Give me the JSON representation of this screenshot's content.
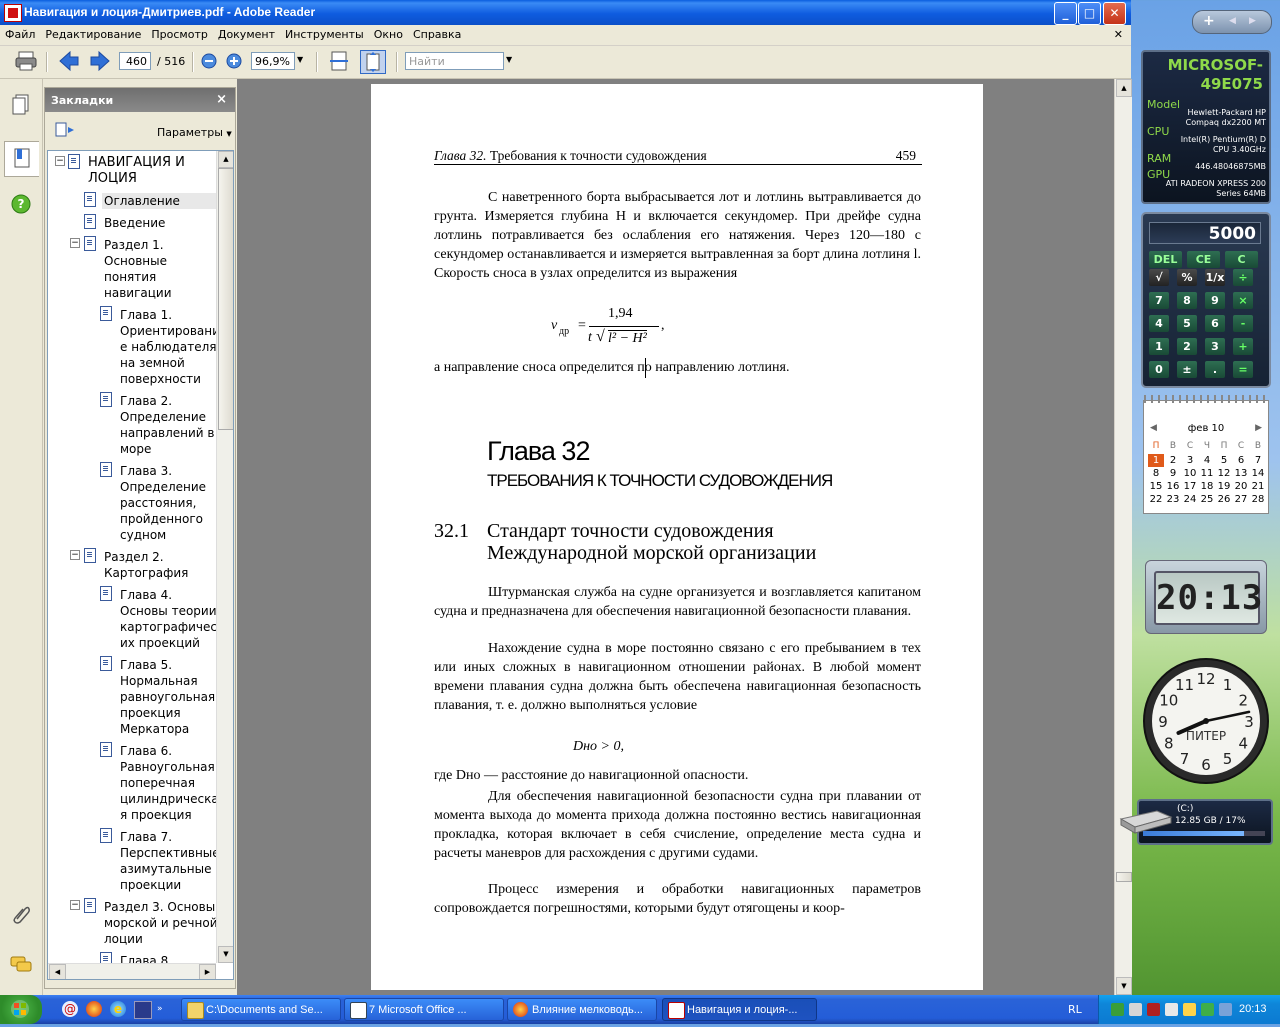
{
  "window": {
    "title": "Навигация и лоция-Дмитриев.pdf - Adobe Reader",
    "controls": {
      "minimize": "_",
      "maximize": "□",
      "close": "✕"
    }
  },
  "menu": [
    "Файл",
    "Редактирование",
    "Просмотр",
    "Документ",
    "Инструменты",
    "Окно",
    "Справка"
  ],
  "menu_close": "✕",
  "toolbar": {
    "page_current": "460",
    "page_total": "/ 516",
    "zoom": "96,9%",
    "search_placeholder": "Найти"
  },
  "bookmarks": {
    "title": "Закладки",
    "close": "×",
    "options_label": "Параметры",
    "items": [
      {
        "text": "НАВИГАЦИЯ И\nЛОЦИЯ"
      },
      {
        "text": "Оглавление"
      },
      {
        "text": "Введение"
      },
      {
        "text": "Раздел 1.\nОсновные\nпонятия\nнавигации"
      },
      {
        "text": "Глава 1.\nОриентировани\nе наблюдателя\nна земной\nповерхности"
      },
      {
        "text": "Глава 2.\nОпределение\nнаправлений в\nморе"
      },
      {
        "text": "Глава 3.\nОпределение\nрасстояния,\nпройденного\nсудном"
      },
      {
        "text": "Раздел 2.\nКартография"
      },
      {
        "text": "Глава 4.\nОсновы теории\nкартографическ\nих проекций"
      },
      {
        "text": "Глава 5.\nНормальная\nравноугольная\nпроекция\nМеркатора"
      },
      {
        "text": "Глава 6.\nРавноугольная\nпоперечная\nцилиндрическа\nя проекция"
      },
      {
        "text": "Глава 7.\nПерспективные\nазимутальные\nпроекции"
      },
      {
        "text": "Раздел 3. Основы\nморской и речной\nлоции"
      },
      {
        "text": "Глава 8."
      }
    ]
  },
  "page": {
    "header_left_italic": "Глава 32.",
    "header_left": " Требования к точности судовождения",
    "header_page": "459",
    "p1": "С наветренного борта выбрасывается лот и лотлинь вытравливается до грунта. Измеряется глубина H и включается секундомер. При дрейфе судна лотлинь потравливается без ослабления его натяжения. Через 120—180 с секундомер останавливается и измеряется вытравленная за борт длина лотлиня l. Скорость сноса в узлах определится из выражения",
    "formula1": {
      "lhs": "v",
      "lhs_sub": "др",
      "eq": "=",
      "num": "1,94",
      "den_t": "t",
      "den_rad": "l² − H²",
      "comma": ","
    },
    "p2": "а направление сноса определится по направлению лотлиня.",
    "chapter_title": "Глава 32",
    "chapter_subtitle": "ТРЕБОВАНИЯ К ТОЧНОСТИ СУДОВОЖДЕНИЯ",
    "section_number": "32.1",
    "section_title_1": "Стандарт точности судовождения",
    "section_title_2": "Международной морской организации",
    "p3": "Штурманская служба на судне организуется и возглавляется капитаном судна и предназначена для обеспечения навигационной безопасности плавания.",
    "p4": "Нахождение судна в море постоянно связано с его пребыванием в тех или иных сложных в навигационном отношении районах. В любой момент времени плавания судна должна быть обеспечена навигационная безопасность плавания, т. е. должно выполняться условие",
    "formula2": "Dно > 0,",
    "p5": "где Dно — расстояние до навигационной опасности.",
    "p6": "Для обеспечения навигационной безопасности судна при плавании от момента выхода до момента прихода должна постоянно вестись навигационная прокладка, которая включает в себя счисление, определение места судна и расчеты маневров для расхождения с другими судами.",
    "p7": "Процесс измерения и обработки навигационных параметров сопровождается погрешностями, которыми будут отягощены и коор-"
  },
  "gadgets": {
    "sysinfo": {
      "name": "MICROSOF-\n49E075",
      "model_label": "Model",
      "model": "Hewlett-Packard HP\nCompaq dx2200 MT",
      "cpu_label": "CPU",
      "cpu": "Intel(R) Pentium(R) D\nCPU 3.40GHz",
      "ram_label": "RAM",
      "ram": "446.48046875MB",
      "gpu_label": "GPU",
      "gpu": "ATI RADEON XPRESS 200\nSeries 64MB"
    },
    "calculator": {
      "display": "5000",
      "keys": [
        [
          "DEL",
          "CE",
          "C"
        ],
        [
          "√",
          "%",
          "1/x",
          "÷"
        ],
        [
          "7",
          "8",
          "9",
          "×"
        ],
        [
          "4",
          "5",
          "6",
          "-"
        ],
        [
          "1",
          "2",
          "3",
          "+"
        ],
        [
          "0",
          "±",
          ".",
          "="
        ]
      ]
    },
    "calendar": {
      "month": "фев 10",
      "weekdays": [
        "П",
        "В",
        "С",
        "Ч",
        "П",
        "С",
        "В"
      ],
      "weeks": [
        [
          "1",
          "2",
          "3",
          "4",
          "5",
          "6",
          "7"
        ],
        [
          "8",
          "9",
          "10",
          "11",
          "12",
          "13",
          "14"
        ],
        [
          "15",
          "16",
          "17",
          "18",
          "19",
          "20",
          "21"
        ],
        [
          "22",
          "23",
          "24",
          "25",
          "26",
          "27",
          "28"
        ]
      ],
      "today": "1"
    },
    "digital_clock": "20:13",
    "analog_clock": {
      "city": "ПИТЕР",
      "hour": 20,
      "minute": 13,
      "numbers": [
        "12",
        "1",
        "2",
        "3",
        "4",
        "5",
        "6",
        "7",
        "8",
        "9",
        "10",
        "11"
      ]
    },
    "drive": {
      "label": "(C:)",
      "info": "12.85 GB / 17%",
      "fill_fraction": 0.83
    }
  },
  "taskbar": {
    "tasks": [
      {
        "label": "C:\\Documents and Se..."
      },
      {
        "label": "7 Microsoft Office ..."
      },
      {
        "label": "Влияние мелководь..."
      },
      {
        "label": "Навигация и лоция-..."
      }
    ],
    "lang": "RL",
    "time": "20:13"
  },
  "colors": {
    "xp_blue": "#245dd8",
    "tray_blue": "#0e86d9",
    "start_green": "#2e8c2a",
    "doc_gray": "#808080"
  }
}
